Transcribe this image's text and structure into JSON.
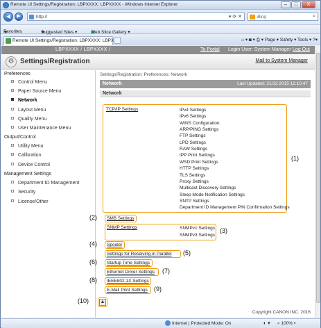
{
  "window": {
    "title": "Remote UI Settings/Registration: LBPXXXX: LBPXXXX - Windows Internet Explorer",
    "min": "–",
    "max": "□",
    "close": "X"
  },
  "browser": {
    "address": "http://",
    "search_placeholder": "Bing",
    "favorites": [
      "Favorites",
      "Suggested Sites ▾",
      "Web Slice Gallery ▾"
    ],
    "tab_title": "Remote UI Settings/Registration: LBPXXXX: LBPXX...",
    "commands": "Page ▾   Safety ▾   Tools ▾",
    "status_zone": "Internet | Protected Mode: On",
    "zoom": "100%"
  },
  "app": {
    "model": "LBPXXXX / LBPXXXX /",
    "portal": "To Portal",
    "login": "Login User: System Manager",
    "logout": "Log Out",
    "header_title": "Settings/Registration",
    "mail_link": "Mail to System Manager",
    "copyright": "Copyright CANON INC. 2016"
  },
  "sidebar": {
    "groups": [
      {
        "heading": "Preferences",
        "items": [
          "Control Menu",
          "Paper Source Menu",
          "Network",
          "Layout Menu",
          "Quality Menu",
          "User Maintenance Menu"
        ]
      },
      {
        "heading": "Output/Control",
        "items": [
          "Utility Menu",
          "Calibration",
          "Device Control"
        ]
      },
      {
        "heading": "Management Settings",
        "items": [
          "Department ID Management",
          "Security",
          "License/Other"
        ]
      }
    ],
    "active": "Network"
  },
  "main": {
    "breadcrumb": "Settings/Registration: Preferences: Network",
    "section_title": "Network",
    "last_updated": "Last Updated: 21/12 2015 12:10:47",
    "subheading": "Network",
    "tcpip_label": "TCP/IP Settings",
    "tcpip_items": [
      "IPv4 Settings",
      "IPv6 Settings",
      "WINS Configuration",
      "ARP/PING Settings",
      "FTP Settings",
      "LPD Settings",
      "RAW Settings",
      "IPP Print Settings",
      "WSD Print Settings",
      "HTTP Settings",
      "TLS Settings",
      "Proxy Settings",
      "Multicast Discovery Settings",
      "Sleep Mode Notification Settings",
      "SNTP Settings",
      "Department ID Management PIN Confirmation Settings"
    ],
    "smb": "SMB Settings",
    "snmp_label": "SNMP Settings",
    "snmp_items": [
      "SNMPv1 Settings",
      "SNMPv3 Settings"
    ],
    "spooler": "Spooler",
    "parallel": "Settings for Receiving in Parallel",
    "startup": "Startup Time Settings",
    "ethernet": "Ethernet Driver Settings",
    "ieee": "IEEE802.1X Settings",
    "email": "E-Mail Print Settings",
    "to_top": "▲"
  },
  "callouts": [
    "(1)",
    "(2)",
    "(3)",
    "(4)",
    "(5)",
    "(6)",
    "(7)",
    "(8)",
    "(9)",
    "(10)"
  ]
}
